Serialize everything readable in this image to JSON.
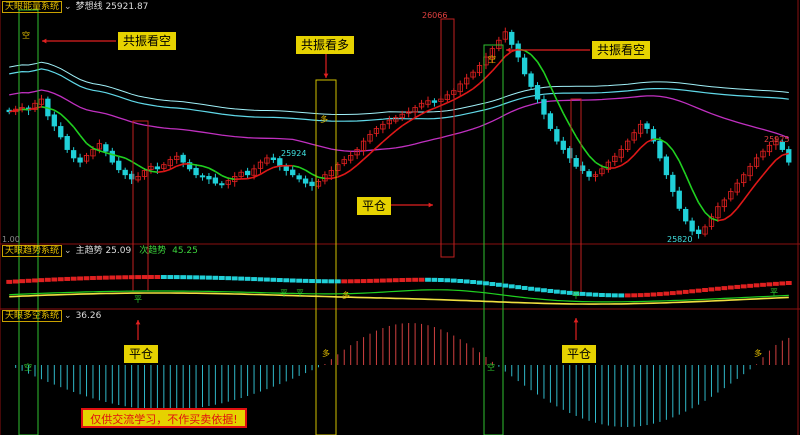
{
  "panels": {
    "main": {
      "name": "天眼能量系统",
      "indicator": "梦想线",
      "value": "25921.87"
    },
    "trend": {
      "name": "天眼趋势系统",
      "main_label": "主趋势",
      "main_value": "25.09",
      "sub_label": "次趋势",
      "sub_value": "45.25"
    },
    "ls": {
      "name": "天眼多空系统",
      "value": "36.26"
    }
  },
  "annotations": {
    "sell1": "共振看空",
    "buy": "共振看多",
    "sell2": "共振看空",
    "close_main": "平仓",
    "close_left": "平仓",
    "close_right": "平仓",
    "disclaimer": "仅供交流学习，不作买卖依据!"
  },
  "price_labels": {
    "high": "26066",
    "low1": "25924",
    "low2": "25820",
    "right_high": "25925"
  },
  "chart_marks": {
    "sell": "空",
    "buy": "多",
    "flat": "平",
    "y_corner": "1.00"
  },
  "colors": {
    "up": "#e02020",
    "down": "#20d0d8",
    "ma_red": "#e01818",
    "ma_green": "#20d020",
    "magenta": "#c030c0",
    "cyan_band": "#60d8e8",
    "frame_green": "#30c030",
    "frame_yellow": "#d0c000",
    "frame_red": "#c02020"
  },
  "chart_data": {
    "type": "candlestick",
    "title": "天眼能量系统",
    "closes": [
      25965,
      25968,
      25970,
      25967,
      25975,
      25980,
      25960,
      25948,
      25935,
      25920,
      25910,
      25905,
      25913,
      25920,
      25927,
      25918,
      25905,
      25896,
      25890,
      25885,
      25888,
      25895,
      25900,
      25897,
      25902,
      25908,
      25912,
      25905,
      25897,
      25890,
      25888,
      25885,
      25880,
      25878,
      25883,
      25888,
      25893,
      25890,
      25897,
      25905,
      25910,
      25908,
      25900,
      25895,
      25890,
      25885,
      25880,
      25877,
      25882,
      25890,
      25895,
      25902,
      25908,
      25913,
      25920,
      25930,
      25938,
      25945,
      25950,
      25955,
      25958,
      25962,
      25965,
      25970,
      25975,
      25978,
      25976,
      25980,
      25985,
      25990,
      25998,
      26005,
      26012,
      26020,
      26030,
      26040,
      26050,
      26060,
      26045,
      26030,
      26010,
      25995,
      25980,
      25962,
      25945,
      25930,
      25920,
      25910,
      25900,
      25895,
      25888,
      25890,
      25897,
      25905,
      25912,
      25920,
      25930,
      25940,
      25950,
      25945,
      25930,
      25910,
      25890,
      25870,
      25850,
      25835,
      25823,
      25820,
      25828,
      25840,
      25852,
      25860,
      25870,
      25880,
      25890,
      25900,
      25910,
      25918,
      25925,
      25930,
      25920,
      25905
    ],
    "series": [
      {
        "name": "梦想线",
        "values": [
          25921.87
        ]
      },
      {
        "name": "主趋势",
        "values": [
          25.09
        ]
      },
      {
        "name": "次趋势",
        "values": [
          45.25
        ]
      },
      {
        "name": "天眼多空系统",
        "values": [
          36.26
        ]
      }
    ]
  }
}
